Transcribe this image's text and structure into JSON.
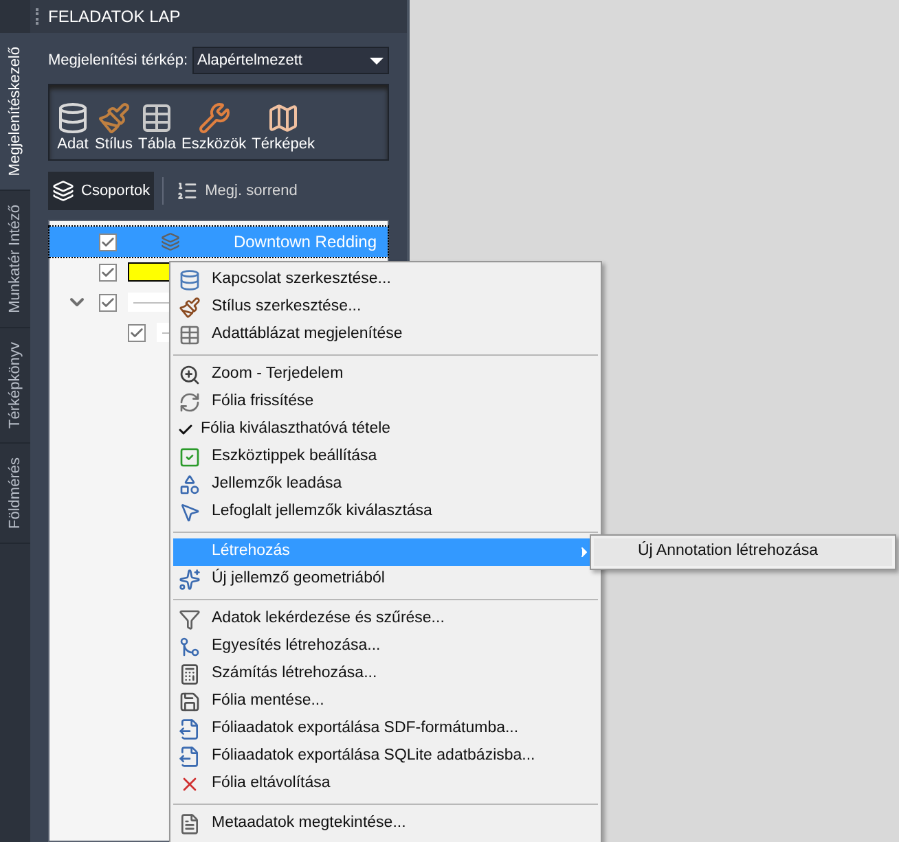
{
  "side_tabs": [
    {
      "label": "Megjelenítéskezelő",
      "selected": true
    },
    {
      "label": "Munkatér Intéző",
      "selected": false
    },
    {
      "label": "Térképkönyv",
      "selected": false
    },
    {
      "label": "Földmérés",
      "selected": false
    }
  ],
  "panel": {
    "title": "FELADATOK LAP",
    "map_label": "Megjelenítési térkép:",
    "map_value": "Alapértelmezett",
    "tools": [
      {
        "label": "Adat"
      },
      {
        "label": "Stílus"
      },
      {
        "label": "Tábla"
      },
      {
        "label": "Eszközök"
      },
      {
        "label": "Térképek"
      }
    ],
    "view_tabs": [
      {
        "label": "Csoportok",
        "selected": true
      },
      {
        "label": "Megj. sorrend",
        "selected": false
      }
    ],
    "tree": [
      {
        "kind": "layer",
        "label": "Downtown Redding",
        "checked": true,
        "selected": true
      },
      {
        "kind": "style",
        "color": "#ffff00",
        "checked": true,
        "selected": false
      },
      {
        "kind": "group",
        "checked": true,
        "expanded": true,
        "selected": false,
        "children": [
          {
            "kind": "rule",
            "checked": true,
            "selected": false
          }
        ]
      }
    ]
  },
  "context_menu": {
    "groups": [
      [
        {
          "label": "Kapcsolat szerkesztése...",
          "kind": "command",
          "checked": false,
          "selected": false
        },
        {
          "label": "Stílus szerkesztése...",
          "kind": "command",
          "checked": false,
          "selected": false
        },
        {
          "label": "Adattáblázat megjelenítése",
          "kind": "command",
          "checked": false,
          "selected": false
        }
      ],
      [
        {
          "label": "Zoom - Terjedelem",
          "kind": "command",
          "checked": false,
          "selected": false
        },
        {
          "label": "Fólia frissítése",
          "kind": "command",
          "checked": false,
          "selected": false
        },
        {
          "label": "Fólia kiválaszthatóvá tétele",
          "kind": "command",
          "checked": true,
          "selected": false
        },
        {
          "label": "Eszköztippek beállítása",
          "kind": "command",
          "checked": false,
          "selected": false
        },
        {
          "label": "Jellemzők leadása",
          "kind": "command",
          "checked": false,
          "selected": false
        },
        {
          "label": "Lefoglalt jellemzők kiválasztása",
          "kind": "command",
          "checked": false,
          "selected": false
        }
      ],
      [
        {
          "label": "Létrehozás",
          "kind": "submenu",
          "checked": false,
          "selected": true
        },
        {
          "label": "Új jellemző geometriából",
          "kind": "command",
          "checked": false,
          "selected": false
        }
      ],
      [
        {
          "label": "Adatok lekérdezése és szűrése...",
          "kind": "command",
          "checked": false,
          "selected": false
        },
        {
          "label": "Egyesítés létrehozása...",
          "kind": "command",
          "checked": false,
          "selected": false
        },
        {
          "label": "Számítás létrehozása...",
          "kind": "command",
          "checked": false,
          "selected": false
        },
        {
          "label": "Fólia mentése...",
          "kind": "command",
          "checked": false,
          "selected": false
        },
        {
          "label": "Fóliaadatok exportálása SDF-formátumba...",
          "kind": "command",
          "checked": false,
          "selected": false
        },
        {
          "label": "Fóliaadatok exportálása SQLite adatbázisba...",
          "kind": "command",
          "checked": false,
          "selected": false
        },
        {
          "label": "Fólia eltávolítása",
          "kind": "command",
          "checked": false,
          "selected": false
        }
      ],
      [
        {
          "label": "Metaadatok megtekintése...",
          "kind": "command",
          "checked": false,
          "selected": false
        }
      ]
    ]
  },
  "submenu": {
    "items": [
      {
        "label": "Új Annotation létrehozása",
        "selected": false
      }
    ]
  }
}
